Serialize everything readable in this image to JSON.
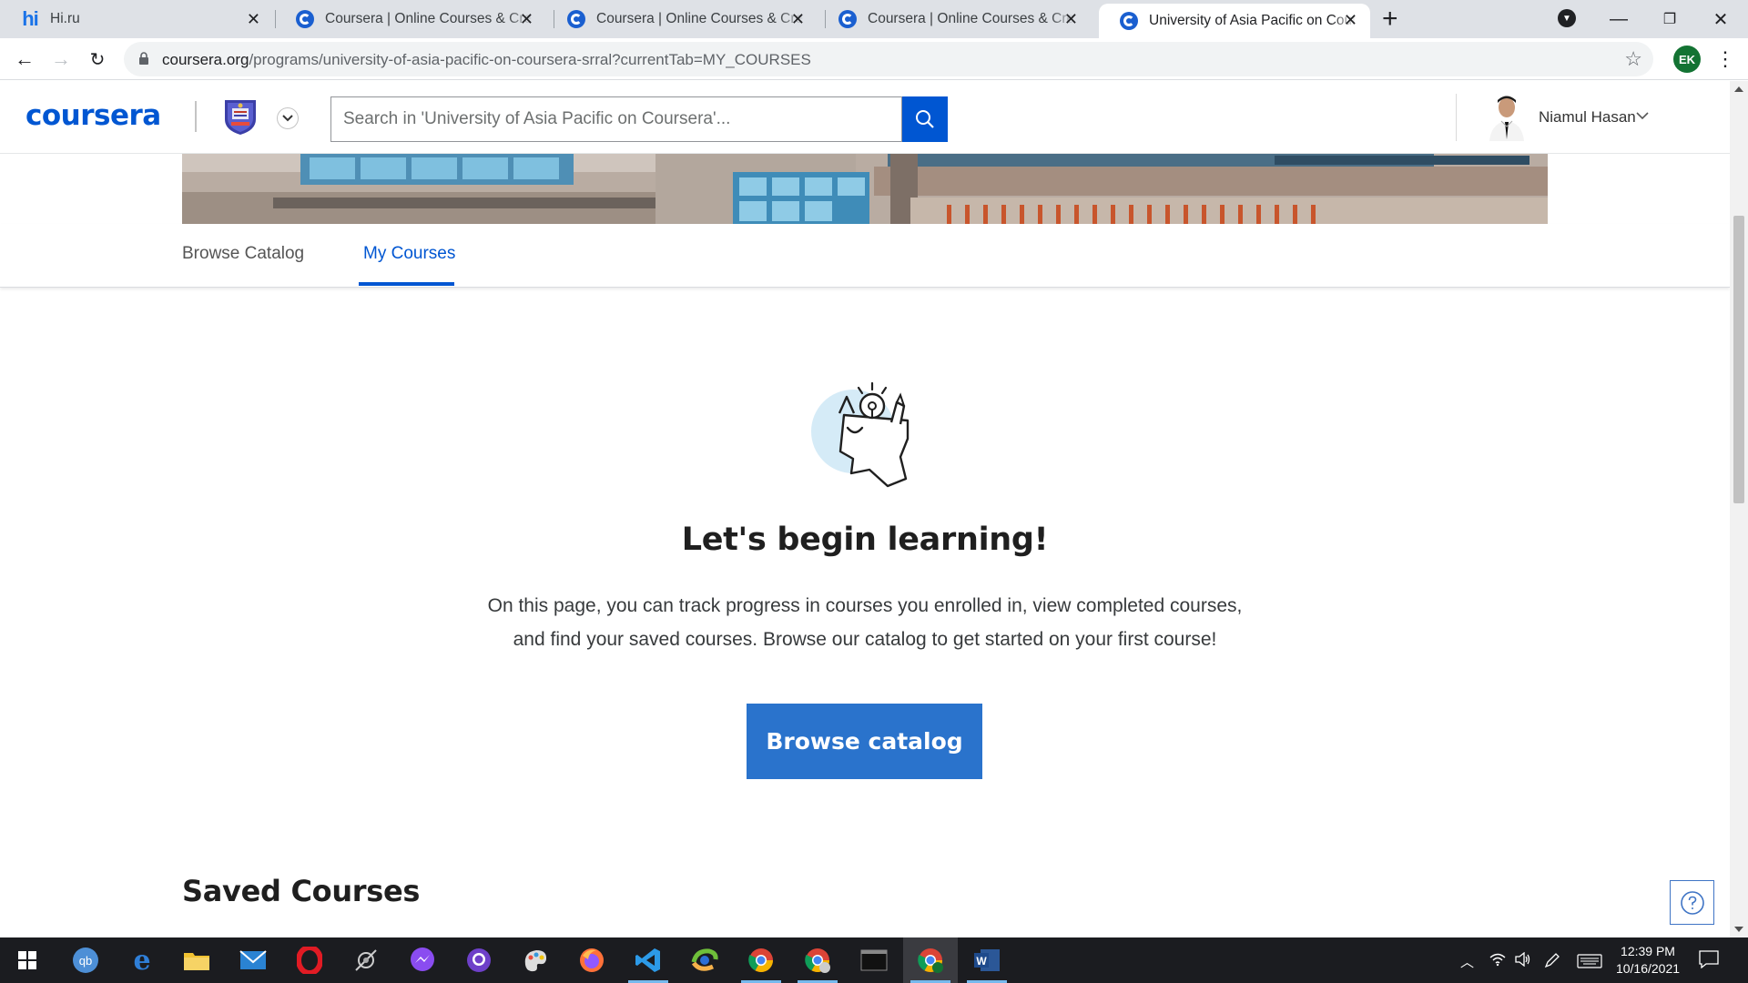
{
  "browser": {
    "tabs": [
      {
        "title": "Hi.ru",
        "favicon": "hi-favicon-icon",
        "active": false
      },
      {
        "title": "Coursera | Online Courses & Credentials",
        "favicon": "coursera-favicon-icon",
        "active": false
      },
      {
        "title": "Coursera | Online Courses & Credentials",
        "favicon": "coursera-favicon-icon",
        "active": false
      },
      {
        "title": "Coursera | Online Courses & Credentials",
        "favicon": "coursera-favicon-icon",
        "active": false
      },
      {
        "title": "University of Asia Pacific on Coursera",
        "favicon": "coursera-favicon-icon",
        "active": true
      }
    ],
    "url_host": "coursera.org",
    "url_path": "/programs/university-of-asia-pacific-on-coursera-srral?currentTab=MY_COURSES",
    "profile_initials": "EK"
  },
  "header": {
    "logo": "coursera",
    "search_placeholder": "Search in 'University of Asia Pacific on Coursera'...",
    "user_name": "Niamul Hasan"
  },
  "nav_tabs": [
    {
      "label": "Browse Catalog",
      "active": false
    },
    {
      "label": "My Courses",
      "active": true
    }
  ],
  "main": {
    "headline": "Let's begin learning!",
    "description_line1": "On this page, you can track progress in courses you enrolled in, view completed courses,",
    "description_line2": "and find your saved courses. Browse our catalog to get started on your first course!",
    "cta_label": "Browse catalog",
    "saved_heading": "Saved Courses"
  },
  "taskbar": {
    "apps": [
      "windows-start-icon",
      "qbittorrent-icon",
      "edge-icon",
      "file-explorer-icon",
      "mail-icon",
      "opera-icon",
      "satellite-icon",
      "messenger-icon",
      "github-desktop-icon",
      "paint-icon",
      "firefox-icon",
      "vscode-icon",
      "chrome-canary-icon",
      "chrome-icon",
      "chrome-profile-icon",
      "terminal-icon",
      "chrome-ek-icon",
      "word-icon"
    ],
    "time": "12:39 PM",
    "date": "10/16/2021"
  },
  "colors": {
    "brand": "#0056d2",
    "cta": "#2a73cc",
    "tab_strip": "#dee1e6"
  }
}
